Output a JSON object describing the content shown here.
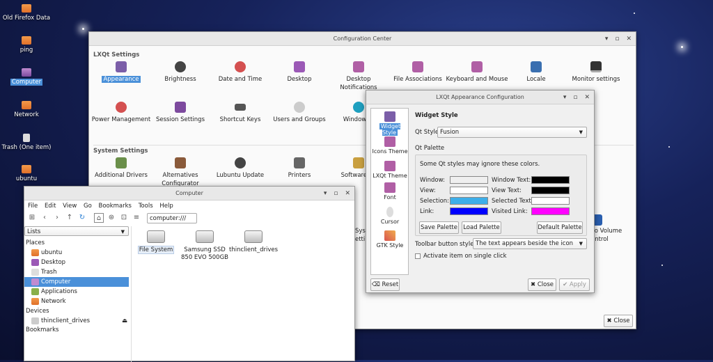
{
  "desktop": {
    "icons": [
      {
        "label": "Old Firefox Data"
      },
      {
        "label": "ping"
      },
      {
        "label": "Computer"
      },
      {
        "label": "Network"
      },
      {
        "label": "Trash (One item)"
      },
      {
        "label": "ubuntu"
      }
    ]
  },
  "config_center": {
    "title": "Configuration Center",
    "lxqt_settings_title": "LXQt Settings",
    "system_settings_title": "System Settings",
    "items": [
      "Appearance",
      "Brightness",
      "Date and Time",
      "Desktop",
      "Desktop Notifications",
      "File Associations",
      "Keyboard and Mouse",
      "Locale",
      "Monitor settings",
      "Power Management",
      "Session Settings",
      "Shortcut Keys",
      "Users and Groups",
      "Window Ef"
    ],
    "system_items": [
      "Additional Drivers",
      "Alternatives Configurator",
      "Lubuntu Update",
      "Printers",
      "Software So"
    ],
    "partial_items": [
      "Syst",
      "etting",
      "lio Volume",
      "ontrol"
    ],
    "close_label": "Close"
  },
  "appearance": {
    "title": "LXQt Appearance Configuration",
    "sidebar": [
      "Widget Style",
      "Icons Theme",
      "LXQt Theme",
      "Font",
      "Cursor",
      "GTK Style"
    ],
    "section_title": "Widget Style",
    "qt_style_label": "Qt Style",
    "qt_style_value": "Fusion",
    "palette_title": "Qt Palette",
    "palette_note": "Some Qt styles may ignore these colors.",
    "palette": [
      {
        "label": "Window:",
        "color": "#efefef"
      },
      {
        "label": "View:",
        "color": "#ffffff"
      },
      {
        "label": "Selection:",
        "color": "#3daee9"
      },
      {
        "label": "Link:",
        "color": "#0000ff"
      },
      {
        "label": "Window Text:",
        "color": "#000000"
      },
      {
        "label": "View Text:",
        "color": "#000000"
      },
      {
        "label": "Selected Text:",
        "color": "#ffffff"
      },
      {
        "label": "Visited Link:",
        "color": "#ff00ff"
      }
    ],
    "save_palette": "Save Palette",
    "load_palette": "Load Palette",
    "default_palette": "Default Palette",
    "toolbar_style_label": "Toolbar button style:",
    "toolbar_style_value": "The text appears beside the icon",
    "single_click_label": "Activate item on single click",
    "reset_label": "Reset",
    "close_label": "Close",
    "apply_label": "Apply"
  },
  "file_manager": {
    "title": "Computer",
    "menu": [
      "File",
      "Edit",
      "View",
      "Go",
      "Bookmarks",
      "Tools",
      "Help"
    ],
    "path": "computer:///",
    "side_view": "Lists",
    "places_title": "Places",
    "places": [
      "ubuntu",
      "Desktop",
      "Trash",
      "Computer",
      "Applications",
      "Network"
    ],
    "devices_title": "Devices",
    "devices": [
      "thinclient_drives"
    ],
    "bookmarks_title": "Bookmarks",
    "items": [
      "File System",
      "Samsung SSD 850 EVO 500GB",
      "thinclient_drives"
    ]
  }
}
